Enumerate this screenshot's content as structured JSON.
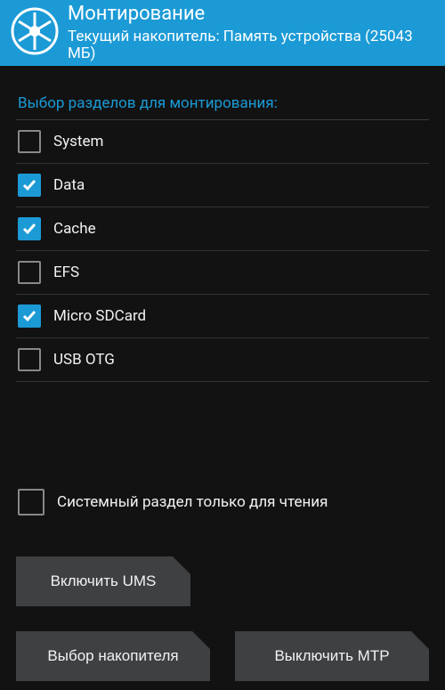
{
  "header": {
    "title": "Монтирование",
    "subtitle": "Текущий накопитель: Память устройства (25043 МБ)"
  },
  "section_label": "Выбор разделов для монтирования:",
  "partitions": [
    {
      "label": "System",
      "checked": false
    },
    {
      "label": "Data",
      "checked": true
    },
    {
      "label": "Cache",
      "checked": true
    },
    {
      "label": "EFS",
      "checked": false
    },
    {
      "label": "Micro SDCard",
      "checked": true
    },
    {
      "label": "USB OTG",
      "checked": false
    }
  ],
  "readonly": {
    "label": "Системный раздел только для чтения",
    "checked": false
  },
  "buttons": {
    "ums": "Включить UMS",
    "select_storage": "Выбор накопителя",
    "mtp": "Выключить MTP"
  }
}
